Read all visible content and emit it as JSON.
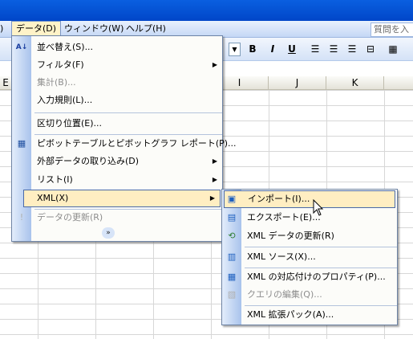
{
  "menubar": {
    "items": [
      {
        "label": "データ(D)",
        "active": true
      },
      {
        "label": "ウィンドウ(W)"
      },
      {
        "label": "ヘルプ(H)"
      }
    ],
    "help_box": "質問を入"
  },
  "toolbar": {
    "bold": "B",
    "italic": "I",
    "underline": "U"
  },
  "columns": [
    "E",
    "I",
    "J",
    "K"
  ],
  "data_menu": {
    "items": [
      {
        "label": "並べ替え(S)..."
      },
      {
        "label": "フィルタ(F)"
      },
      {
        "label": "集計(B)..."
      },
      {
        "label": "入力規則(L)..."
      },
      {
        "label": "区切り位置(E)..."
      },
      {
        "label": "ピボットテーブルとピボットグラフ レポート(P)..."
      },
      {
        "label": "外部データの取り込み(D)"
      },
      {
        "label": "リスト(I)"
      },
      {
        "label": "XML(X)"
      },
      {
        "label": "データの更新(R)"
      }
    ],
    "expand": "»"
  },
  "xml_menu": {
    "items": [
      {
        "label": "インポート(I)..."
      },
      {
        "label": "エクスポート(E)..."
      },
      {
        "label": "XML データの更新(R)"
      },
      {
        "label": "XML ソース(X)..."
      },
      {
        "label": "XML の対応付けのプロパティ(P)..."
      },
      {
        "label": "クエリの編集(Q)..."
      },
      {
        "label": "XML 拡張パック(A)..."
      }
    ]
  }
}
